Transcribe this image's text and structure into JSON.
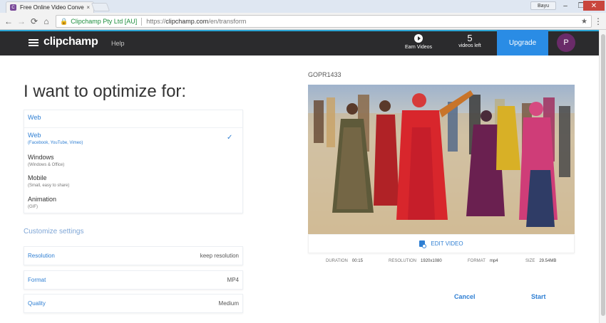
{
  "browser": {
    "tab_title": "Free Online Video Conve",
    "tab_close": "×",
    "user_chip": "Bayu",
    "win_min": "–",
    "win_max": "❐",
    "win_close": "✕",
    "back_icon": "arrow-left",
    "forward_icon": "arrow-right",
    "home_icon": "home",
    "secure_label": "Clipchamp Pty Ltd [AU]",
    "url_prefix": "https://",
    "url_main": "clipchamp.com",
    "url_path": "/en/transform",
    "star_icon": "★"
  },
  "header": {
    "logo": "clipchamp",
    "help": "Help",
    "earn_label": "Earn Videos",
    "videos_count": "5",
    "videos_label": "videos left",
    "upgrade": "Upgrade",
    "avatar_letter": "P"
  },
  "optimize": {
    "heading": "I want to optimize for:",
    "list_head": "Web",
    "options": [
      {
        "title": "Web",
        "sub": "(Facebook, YouTube, Vimeo)",
        "selected": true
      },
      {
        "title": "Windows",
        "sub": "(Windows & Office)"
      },
      {
        "title": "Mobile",
        "sub": "(Small, easy to share)"
      },
      {
        "title": "Animation",
        "sub": "(GIF)"
      }
    ]
  },
  "settings": {
    "heading": "Customize settings",
    "rows": [
      {
        "key": "Resolution",
        "value": "keep resolution"
      },
      {
        "key": "Format",
        "value": "MP4"
      },
      {
        "key": "Quality",
        "value": "Medium"
      }
    ]
  },
  "video": {
    "filename": "GOPR1433",
    "edit_label": "EDIT VIDEO",
    "duration_label": "DURATION",
    "duration": "00:15",
    "resolution_label": "RESOLUTION",
    "resolution": "1920x1080",
    "format_label": "FORMAT",
    "format": "mp4",
    "size_label": "SIZE",
    "size": "29.54MB"
  },
  "actions": {
    "cancel": "Cancel",
    "start": "Start"
  }
}
